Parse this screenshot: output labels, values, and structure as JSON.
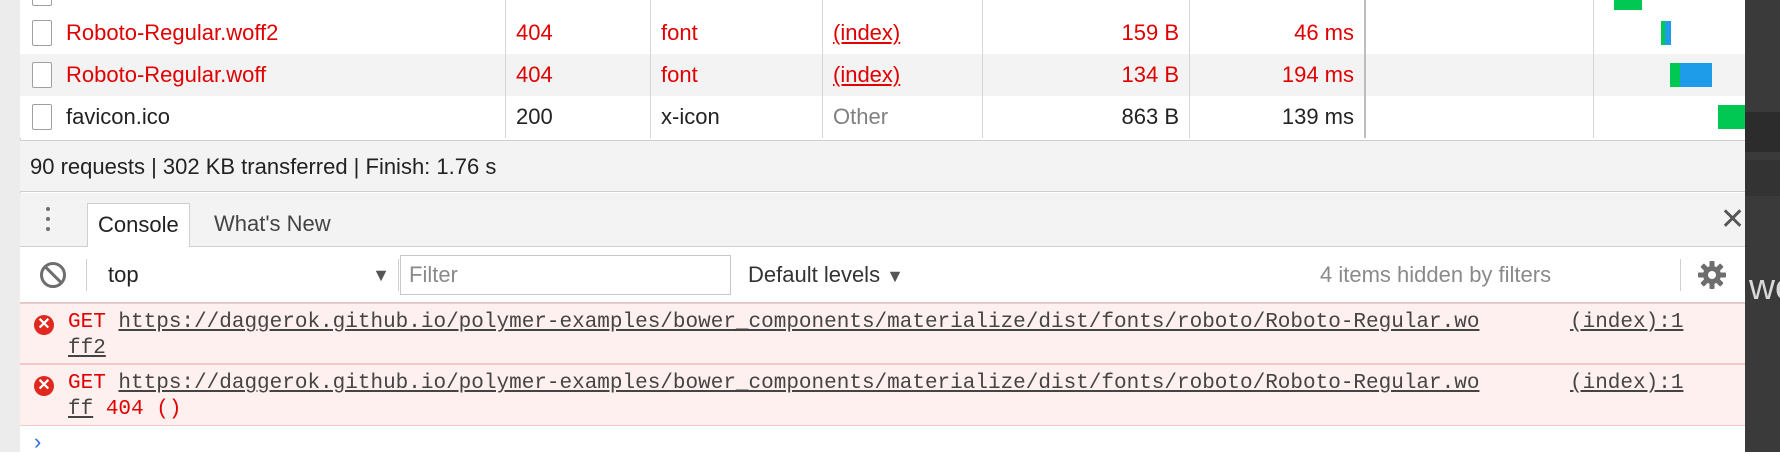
{
  "network": {
    "rows": [
      {
        "name": "Roboto-Regular.woff2",
        "status": "404",
        "type": "font",
        "initiator": "(index)",
        "size": "159 B",
        "time": "46 ms"
      },
      {
        "name": "Roboto-Regular.woff",
        "status": "404",
        "type": "font",
        "initiator": "(index)",
        "size": "134 B",
        "time": "194 ms"
      },
      {
        "name": "favicon.ico",
        "status": "200",
        "type": "x-icon",
        "initiator": "Other",
        "size": "863 B",
        "time": "139 ms"
      }
    ],
    "colors": {
      "error": "#e00000",
      "waterfall_green": "#00c853",
      "waterfall_blue": "#1e9be9"
    }
  },
  "status_bar": {
    "summary": "90 requests | 302 KB transferred | Finish: 1.76 s"
  },
  "drawer": {
    "tabs": [
      {
        "label": "Console"
      },
      {
        "label": "What's New"
      }
    ]
  },
  "console_toolbar": {
    "context": "top",
    "filter_placeholder": "Filter",
    "levels": "Default levels",
    "hidden": "4 items hidden by filters"
  },
  "console_messages": [
    {
      "method": "GET",
      "url": "https://daggerok.github.io/polymer-examples/bower_components/materialize/dist/fonts/roboto/Roboto-Regular.wo",
      "cont": "ff2",
      "suffix": "",
      "source": "(index):1"
    },
    {
      "method": "GET",
      "url": "https://daggerok.github.io/polymer-examples/bower_components/materialize/dist/fonts/roboto/Roboto-Regular.wo",
      "cont": "ff",
      "suffix": "404 ()",
      "source": "(index):1"
    }
  ],
  "side_fragment": "we"
}
